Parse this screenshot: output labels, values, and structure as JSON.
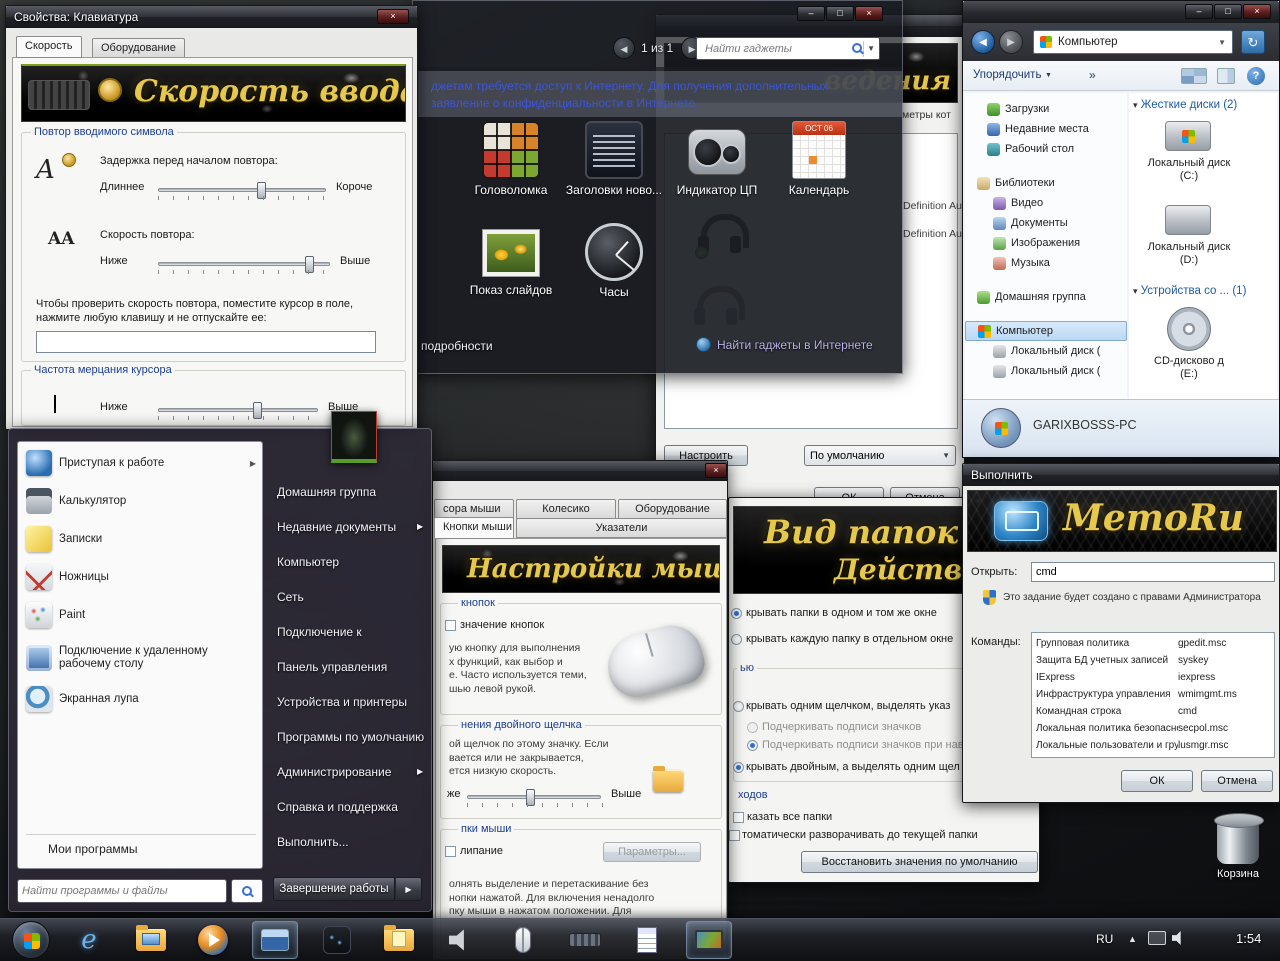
{
  "icons": {
    "close": "×",
    "minimize": "–",
    "maximize": "□",
    "back": "◀",
    "forward": "▶",
    "refresh": "↻",
    "dropdown": "▼",
    "submenu": "▶",
    "collapse": "▾",
    "chevron": "»",
    "help": "?",
    "tray_up": "▲",
    "ie_letter": "e"
  },
  "keyboard": {
    "title": "Свойства: Клавиатура",
    "tab_speed": "Скорость",
    "tab_hardware": "Оборудование",
    "banner": "Скорость ввода",
    "group_repeat": "Повтор вводимого символа",
    "delay_label": "Задержка перед началом повтора:",
    "delay_left": "Длиннее",
    "delay_right": "Короче",
    "rate_label": "Скорость повтора:",
    "rate_left": "Ниже",
    "rate_right": "Выше",
    "test_hint": "Чтобы проверить скорость повтора, поместите курсор в поле, нажмите любую клавишу и не отпускайте ее:",
    "group_blink": "Частота мерцания курсора",
    "blink_left": "Ниже",
    "blink_right": "Выше",
    "icon_a": "A",
    "icon_aa": "AA"
  },
  "gadgets": {
    "page": "1 из 1",
    "search_placeholder": "Найти гаджеты",
    "info_line1": "джетам требуется доступ к Интернету. Для получения дополнительных",
    "info_line2": "заявление о конфиденциальности в Интернете.",
    "items": [
      "Головоломка",
      "Заголовки ново...",
      "Индикатор ЦП",
      "Календарь",
      "Показ слайдов",
      "Часы"
    ],
    "calendar_header": "OCT 06",
    "details_link": "подробности",
    "footer_link": "Найти гаджеты в Интернете"
  },
  "sound": {
    "banner": "ведения",
    "fragment": "метры кот",
    "device1": "Definition Au",
    "device2": "Definition Au",
    "configure": "Настроить",
    "dropdown": "По умолчанию",
    "ok": "ОК",
    "cancel": "Отмена"
  },
  "explorer": {
    "address": "Компьютер",
    "organize": "Упорядочить",
    "nav": [
      "Загрузки",
      "Недавние места",
      "Рабочий стол",
      "Библиотеки",
      "Видео",
      "Документы",
      "Изображения",
      "Музыка",
      "Домашняя группа",
      "Компьютер",
      "Локальный диск (",
      "Локальный диск ("
    ],
    "hdd_group": "Жесткие диски (2)",
    "drive_c": "Локальный диск (C:)",
    "drive_d": "Локальный диск (D:)",
    "dev_group": "Устройства со ... (1)",
    "cd": "CD-дисково д (E:)",
    "pc_name": "GARIXBOSSS-PC"
  },
  "run": {
    "title": "Выполнить",
    "banner": "MemoRu",
    "open_label": "Открыть:",
    "open_value": "cmd",
    "uac_text": "Это задание будет создано с правами Администратора",
    "commands_label": "Команды:",
    "commands": [
      {
        "name": "Групповая политика",
        "cmd": "gpedit.msc"
      },
      {
        "name": "Защита БД учетных записей",
        "cmd": "syskey"
      },
      {
        "name": "IExpress",
        "cmd": "iexpress"
      },
      {
        "name": "Инфраструктура управления",
        "cmd": "wmimgmt.ms"
      },
      {
        "name": "Командная строка",
        "cmd": "cmd"
      },
      {
        "name": "Локальная политика безопасности",
        "cmd": "secpol.msc"
      },
      {
        "name": "Локальные пользователи и группы",
        "cmd": "lusmgr.msc"
      }
    ],
    "ok": "ОК",
    "cancel": "Отмена"
  },
  "folders": {
    "script1": "Вид папок",
    "script2": "Действия о",
    "opt_same_window": "крывать папки в одном и том же окне",
    "opt_new_window": "крывать каждую папку в отдельном окне",
    "legend_click": "ью",
    "opt_single_click": "крывать одним щелчком, выделять указ",
    "opt_underline_always": "Подчеркивать подписи значков",
    "opt_underline_hover": "Подчеркивать подписи значков при наве",
    "opt_double_click": "крывать двойным, а выделять одним щел",
    "legend_nav": "ходов",
    "opt_show_all": "казать все папки",
    "opt_auto_expand": "томатически разворачивать до текущей папки",
    "reset": "Восстановить значения по умолчанию"
  },
  "mouse": {
    "tab_pointer_opts": "сора мыши",
    "tab_wheel": "Колесико",
    "tab_hardware": "Оборудование",
    "tab_buttons": "Кнопки мыши",
    "tab_pointers": "Указатели",
    "banner": "Настройки мыши",
    "g1_legend": "кнопок",
    "g1_check": "значение кнопок",
    "g1_lines": [
      "ую кнопку для выполнения",
      "х функций, как выбор и",
      "е. Часто используется теми,",
      "шью левой рукой."
    ],
    "g2_legend": "нения двойного щелчка",
    "g2_lines": [
      "ой щелчок по этому значку. Если",
      "вается или не закрывается,",
      "ется низкую скорость."
    ],
    "g2_left": "же",
    "g2_right": "Выше",
    "g3_legend": "пки мыши",
    "g3_check": "липание",
    "g3_button": "Параметры...",
    "g3_lines": [
      "олнять выделение и перетаскивание без",
      "нопки нажатой. Для включения ненадолго",
      "пку мыши в нажатом положении. Для"
    ]
  },
  "start": {
    "items_left": [
      "Приступая к работе",
      "Калькулятор",
      "Записки",
      "Ножницы",
      "Paint",
      "Подключение к удаленному рабочему столу",
      "Экранная лупа"
    ],
    "my_programs": "Мои программы",
    "search_placeholder": "Найти программы и файлы",
    "items_right": [
      "Домашняя группа",
      "Недавние документы",
      "Компьютер",
      "Сеть",
      "Подключение к",
      "Панель управления",
      "Устройства и принтеры",
      "Программы по умолчанию",
      "Администрирование",
      "Справка и поддержка",
      "Выполнить..."
    ],
    "shutdown": "Завершение работы"
  },
  "taskbar": {
    "lang": "RU",
    "time": "1:54"
  },
  "desktop": {
    "recycle": "Корзина"
  }
}
